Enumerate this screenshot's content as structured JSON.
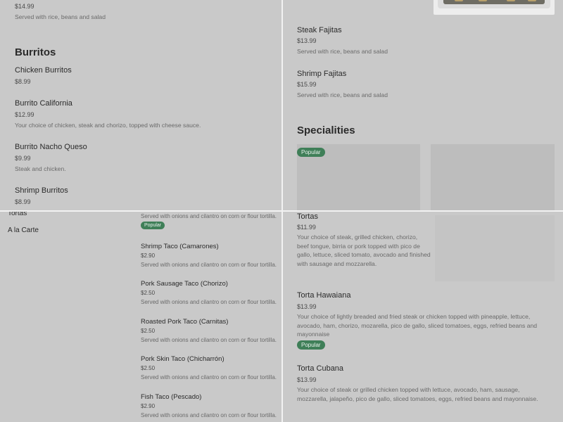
{
  "top_left": {
    "partial_item": {
      "price": "$14.99",
      "desc": "Served with rice, beans and salad"
    },
    "section_title": "Burritos",
    "items": [
      {
        "name": "Chicken Burritos",
        "price": "$8.99",
        "desc": ""
      },
      {
        "name": "Burrito California",
        "price": "$12.99",
        "desc": "Your choice of chicken, steak and chorizo, topped with cheese sauce."
      },
      {
        "name": "Burrito Nacho Queso",
        "price": "$9.99",
        "desc": "Steak and chicken."
      },
      {
        "name": "Shrimp Burritos",
        "price": "$8.99",
        "desc": ""
      }
    ]
  },
  "top_right": {
    "items": [
      {
        "name": "Steak Fajitas",
        "price": "$13.99",
        "desc": "Served with rice, beans and salad"
      },
      {
        "name": "Shrimp Fajitas",
        "price": "$15.99",
        "desc": "Served with rice, beans and salad"
      }
    ],
    "section_title": "Specialities",
    "popular_badge": "Popular"
  },
  "bottom_left": {
    "nav": [
      "Tortas",
      "A la Carte"
    ],
    "partial_desc": "Served with onions and cilantro on corn or flour tortilla.",
    "popular_badge": "Popular",
    "items": [
      {
        "name": "Shrimp Taco (Camarones)",
        "price": "$2.90",
        "desc": "Served with onions and cilantro on corn or flour tortilla."
      },
      {
        "name": "Pork Sausage Taco (Chorizo)",
        "price": "$2.50",
        "desc": "Served with onions and cilantro on corn or flour tortilla."
      },
      {
        "name": "Roasted Pork Taco (Carnitas)",
        "price": "$2.50",
        "desc": "Served with onions and cilantro on corn or flour tortilla."
      },
      {
        "name": "Pork Skin Taco (Chicharrón)",
        "price": "$2.50",
        "desc": "Served with onions and cilantro on corn or flour tortilla."
      },
      {
        "name": "Fish Taco (Pescado)",
        "price": "$2.90",
        "desc": "Served with onions and cilantro on corn or flour tortilla."
      }
    ]
  },
  "bottom_right": {
    "items": [
      {
        "name": "Tortas",
        "price": "$11.99",
        "desc": "Your choice of steak, grilled chicken, chorizo, beef tongue, birria or pork topped with pico de gallo, lettuce, sliced tomato, avocado and finished with sausage and mozzarella."
      },
      {
        "name": "Torta Hawaiana",
        "price": "$13.99",
        "desc": "Your choice of lightly breaded and fried steak or chicken topped with pineapple, lettuce, avocado, ham, chorizo, mozarella, pico de gallo, sliced tomatoes, eggs, refried beans and mayonnaise"
      },
      {
        "name": "Torta Cubana",
        "price": "$13.99",
        "desc": "Your choice of steak or grilled chicken topped with lettuce, avocado, ham, sausage, mozzarella, jalapeño, pico de gallo, sliced tomatoes, eggs, refried beans and mayonnaise."
      }
    ],
    "popular_badge": "Popular"
  }
}
